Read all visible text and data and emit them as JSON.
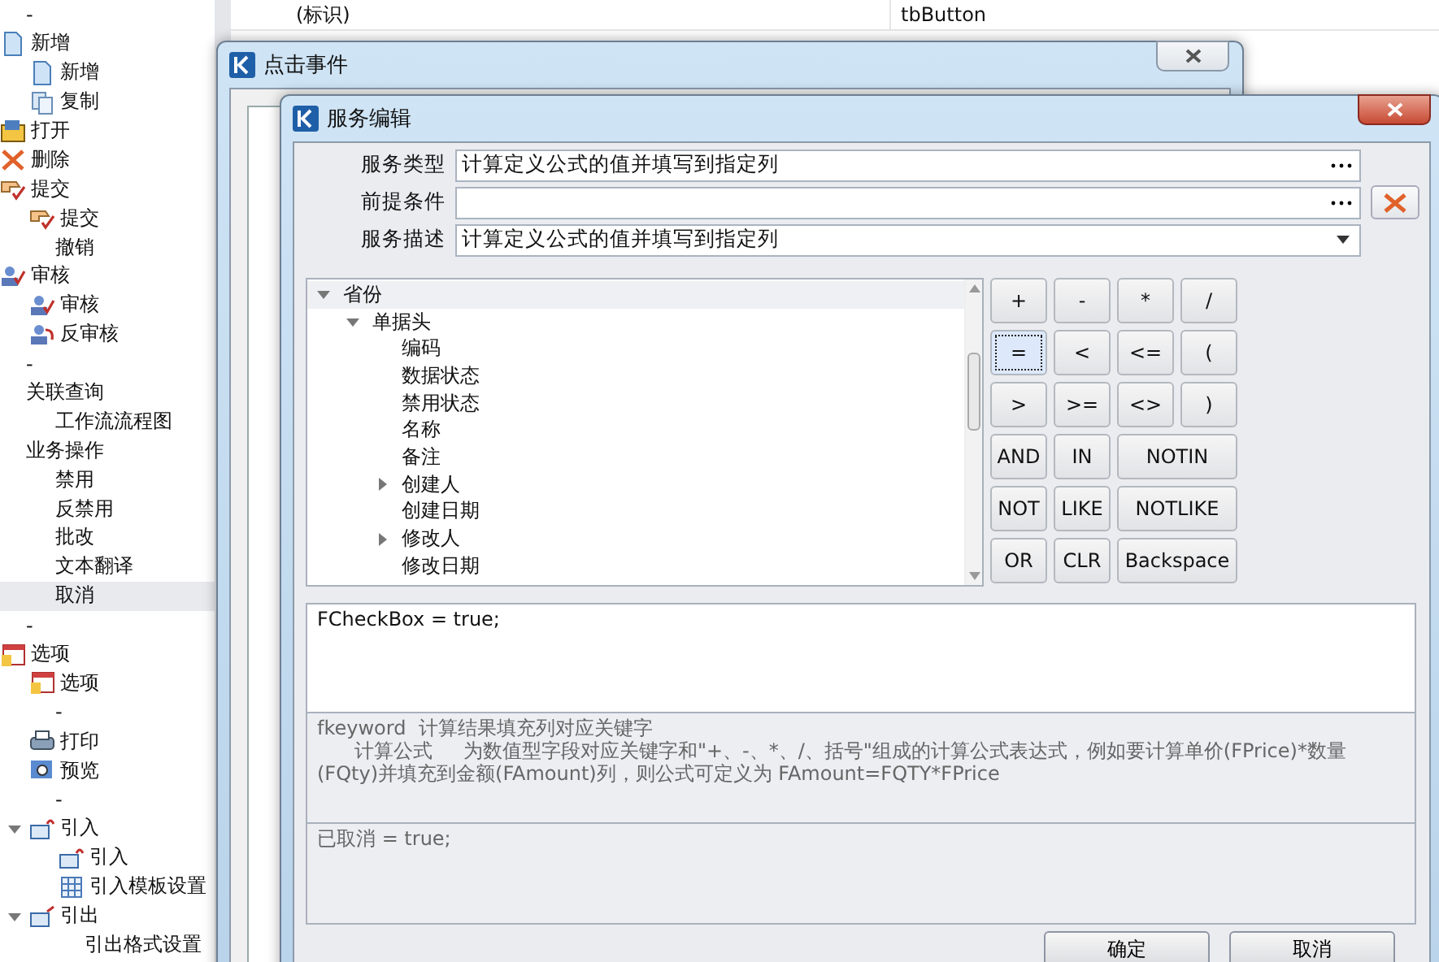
{
  "sidebar": {
    "items": [
      {
        "label": "-",
        "kind": "plain",
        "selected": false
      },
      {
        "label": "新增",
        "kind": "doc",
        "selected": false,
        "children": [
          {
            "label": "新增",
            "kind": "doc",
            "selected": false
          },
          {
            "label": "复制",
            "kind": "copy",
            "selected": false
          }
        ]
      },
      {
        "label": "打开",
        "kind": "open",
        "selected": false
      },
      {
        "label": "删除",
        "kind": "delete",
        "selected": false
      },
      {
        "label": "提交",
        "kind": "submit",
        "selected": false,
        "children": [
          {
            "label": "提交",
            "kind": "submit",
            "selected": false
          },
          {
            "label": "撤销",
            "kind": "plain",
            "selected": false
          }
        ]
      },
      {
        "label": "审核",
        "kind": "audit",
        "selected": false,
        "children": [
          {
            "label": "审核",
            "kind": "audit",
            "selected": false
          },
          {
            "label": "反审核",
            "kind": "unaudit",
            "selected": false
          }
        ]
      },
      {
        "label": "-",
        "kind": "plain",
        "selected": false
      },
      {
        "label": "关联查询",
        "kind": "plain",
        "selected": false,
        "children": [
          {
            "label": "工作流流程图",
            "kind": "plain",
            "selected": false
          }
        ]
      },
      {
        "label": "业务操作",
        "kind": "plain",
        "selected": false,
        "children": [
          {
            "label": "禁用",
            "kind": "plain",
            "selected": false
          },
          {
            "label": "反禁用",
            "kind": "plain",
            "selected": false
          },
          {
            "label": "批改",
            "kind": "plain",
            "selected": false
          },
          {
            "label": "文本翻译",
            "kind": "plain",
            "selected": false
          },
          {
            "label": "取消",
            "kind": "plain",
            "selected": true
          }
        ]
      },
      {
        "label": "-",
        "kind": "plain",
        "selected": false
      },
      {
        "label": "选项",
        "kind": "options",
        "selected": false,
        "children": [
          {
            "label": "选项",
            "kind": "options",
            "selected": false
          },
          {
            "label": "-",
            "kind": "plain",
            "selected": false
          },
          {
            "label": "打印",
            "kind": "print",
            "selected": false
          },
          {
            "label": "预览",
            "kind": "preview",
            "selected": false
          },
          {
            "label": "-",
            "kind": "plain",
            "selected": false
          },
          {
            "label": "引入",
            "kind": "import",
            "selected": false,
            "expanded": true,
            "children": [
              {
                "label": "引入",
                "kind": "import",
                "selected": false
              },
              {
                "label": "引入模板设置",
                "kind": "template",
                "selected": false
              }
            ]
          },
          {
            "label": "引出",
            "kind": "export",
            "selected": false,
            "expanded": true,
            "children": [
              {
                "label": "引出格式设置",
                "kind": "plain",
                "selected": false
              }
            ]
          }
        ]
      }
    ]
  },
  "property_grid": {
    "rows": [
      {
        "name": "(标识)",
        "value": "tbButton"
      }
    ]
  },
  "click_event_dialog": {
    "title": "点击事件"
  },
  "service_dialog": {
    "title": "服务编辑",
    "fields": [
      {
        "label": "服务类型",
        "value": "计算定义公式的值并填写到指定列",
        "kind": "ellipsis"
      },
      {
        "label": "前提条件",
        "kind": "ellipsis"
      },
      {
        "label": "服务描述",
        "value": "计算定义公式的值并填写到指定列",
        "kind": "dropdown"
      }
    ],
    "field_tree": [
      {
        "label": "省份",
        "selected": true,
        "expanded": true,
        "children": [
          {
            "label": "单据头",
            "selected": false,
            "expanded": true,
            "children": [
              {
                "label": "编码",
                "selected": false
              },
              {
                "label": "数据状态",
                "selected": false
              },
              {
                "label": "禁用状态",
                "selected": false
              },
              {
                "label": "名称",
                "selected": false
              },
              {
                "label": "备注",
                "selected": false
              },
              {
                "label": "创建人",
                "selected": false,
                "expanded": false
              },
              {
                "label": "创建日期",
                "selected": false
              },
              {
                "label": "修改人",
                "selected": false,
                "expanded": false
              },
              {
                "label": "修改日期",
                "selected": false
              }
            ]
          }
        ]
      }
    ],
    "operators": [
      {
        "label": "+",
        "kind": "normal",
        "focused": false
      },
      {
        "label": "-",
        "kind": "normal",
        "focused": false
      },
      {
        "label": "*",
        "kind": "normal",
        "focused": false
      },
      {
        "label": "/",
        "kind": "normal",
        "focused": false
      },
      {
        "label": "=",
        "kind": "normal",
        "focused": true
      },
      {
        "label": "<",
        "kind": "normal",
        "focused": false
      },
      {
        "label": "<=",
        "kind": "normal",
        "focused": false
      },
      {
        "label": "(",
        "kind": "normal",
        "focused": false
      },
      {
        "label": ">",
        "kind": "normal",
        "focused": false
      },
      {
        "label": ">=",
        "kind": "normal",
        "focused": false
      },
      {
        "label": "<>",
        "kind": "normal",
        "focused": false
      },
      {
        "label": ")",
        "kind": "normal",
        "focused": false
      },
      {
        "label": "AND",
        "kind": "normal",
        "focused": false
      },
      {
        "label": "IN",
        "kind": "normal",
        "focused": false
      },
      {
        "label": "NOTIN",
        "kind": "wide",
        "focused": false
      },
      {
        "label": "NOT",
        "kind": "normal",
        "focused": false
      },
      {
        "label": "LIKE",
        "kind": "normal",
        "focused": false
      },
      {
        "label": "NOTLIKE",
        "kind": "wide",
        "focused": false
      },
      {
        "label": "OR",
        "kind": "normal",
        "focused": false
      },
      {
        "label": "CLR",
        "kind": "normal",
        "focused": false
      },
      {
        "label": "Backspace",
        "kind": "wide",
        "focused": false
      }
    ],
    "formula": "FCheckBox  = true;",
    "help_lines": [
      "fkeyword  计算结果填充列对应关键字",
      "      计算公式     为数值型字段对应关键字和\"+、-、*、/、括号\"组成的计算公式表达式，例如要计算单价(FPrice)*数量(FQty)并填充到金额(FAmount)列，则公式可定义为 FAmount=FQTY*FPrice"
    ],
    "preview": "已取消  = true;",
    "buttons": [
      "确定",
      "取消"
    ]
  }
}
